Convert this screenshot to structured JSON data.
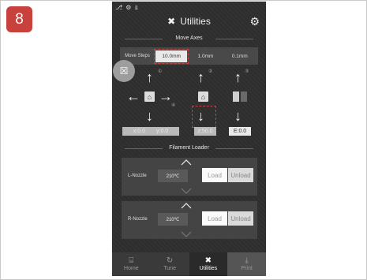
{
  "step_number": "8",
  "status_icons": [
    "wifi-icon",
    "settings-icon",
    "usb-icon"
  ],
  "header": {
    "title": "Utilities"
  },
  "move_axes": {
    "title": "Move Axes",
    "steps_label": "Move Steps",
    "steps": [
      "10.0mm",
      "1.0mm",
      "0.1mm"
    ],
    "selected_step": "10.0mm",
    "markers": [
      "①",
      "②",
      "③",
      "④"
    ],
    "x_label": "x:",
    "x_value": "0.0",
    "y_label": "y:",
    "y_value": "0.0",
    "z_label": "z:",
    "z_value": "50.0",
    "e_label": "E:",
    "e_value": "0.0"
  },
  "filament": {
    "title": "Filament Loader",
    "nozzles": [
      {
        "name": "L-Nozzle",
        "temp": "210℃",
        "load": "Load",
        "unload": "Unload"
      },
      {
        "name": "R-Nozzle",
        "temp": "210℃",
        "load": "Load",
        "unload": "Unload"
      }
    ]
  },
  "nav": {
    "items": [
      {
        "label": "Home",
        "icon": "printer-icon"
      },
      {
        "label": "Tune",
        "icon": "tune-icon"
      },
      {
        "label": "Utilities",
        "icon": "tools-icon"
      },
      {
        "label": "Print",
        "icon": "print-icon"
      }
    ],
    "active": "Utilities"
  },
  "colors": {
    "accent": "#c8413d",
    "screen_bg": "#2e2e2e",
    "panel_bg": "#444444"
  }
}
